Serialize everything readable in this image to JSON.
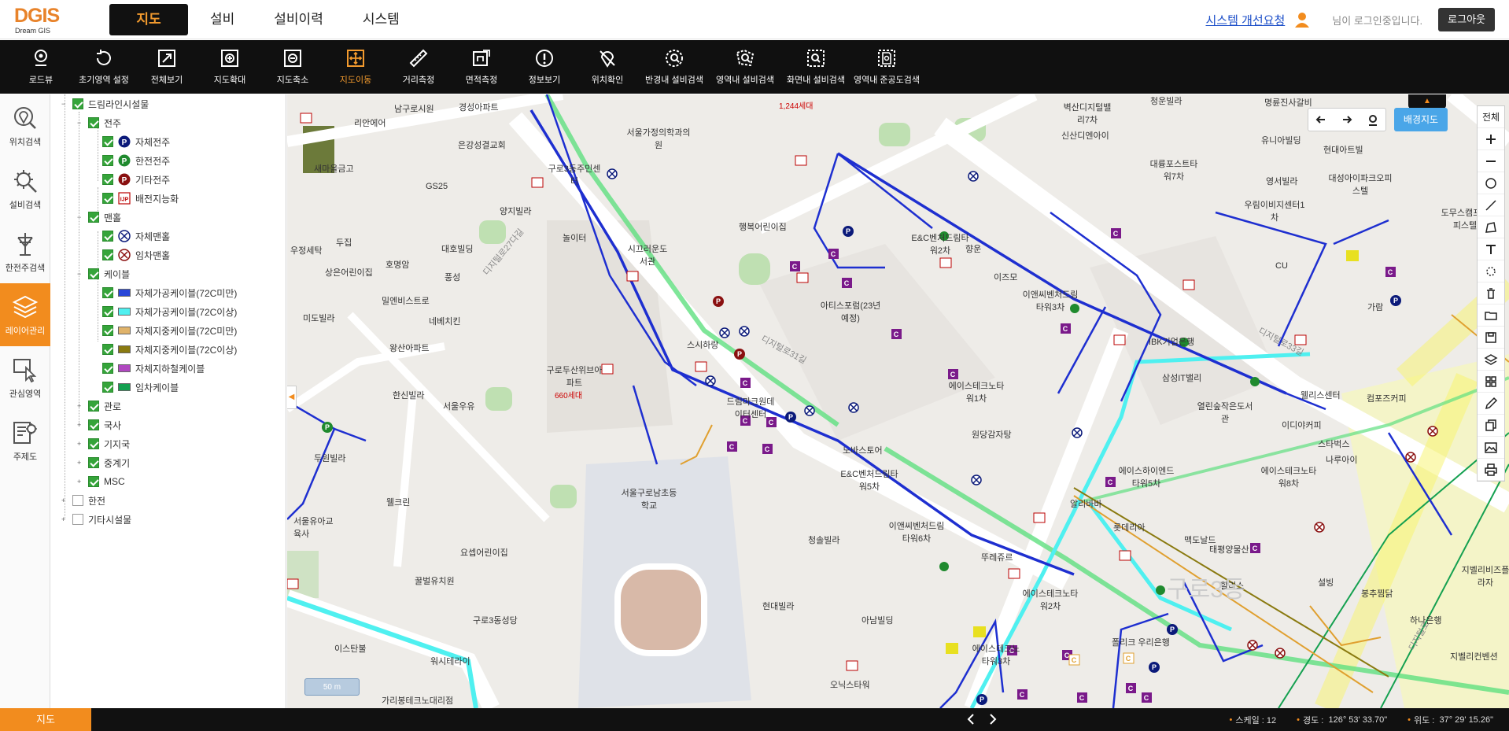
{
  "app": {
    "logo_text": "DGIS",
    "logo_sub": "Dream GIS"
  },
  "header": {
    "nav": [
      "지도",
      "설비",
      "설비이력",
      "시스템"
    ],
    "active_nav": "지도",
    "improve_link": "시스템 개선요청",
    "login_status": "님이 로그인중입니다.",
    "logout_label": "로그아웃"
  },
  "toolbar": {
    "tools": [
      {
        "label": "로드뷰",
        "icon": "roadview-icon"
      },
      {
        "label": "초기영역 설정",
        "icon": "reset-extent-icon"
      },
      {
        "label": "전체보기",
        "icon": "full-extent-icon"
      },
      {
        "label": "지도확대",
        "icon": "zoom-in-icon"
      },
      {
        "label": "지도축소",
        "icon": "zoom-out-icon"
      },
      {
        "label": "지도이동",
        "icon": "pan-icon"
      },
      {
        "label": "거리측정",
        "icon": "ruler-icon"
      },
      {
        "label": "면적측정",
        "icon": "area-measure-icon"
      },
      {
        "label": "정보보기",
        "icon": "info-icon"
      },
      {
        "label": "위치확인",
        "icon": "location-check-icon"
      },
      {
        "label": "반경내 설비검색",
        "icon": "radius-search-icon"
      },
      {
        "label": "영역내 설비검색",
        "icon": "area-search-icon"
      },
      {
        "label": "화면내 설비검색",
        "icon": "screen-search-icon"
      },
      {
        "label": "영역내 준공도검색",
        "icon": "completion-search-icon"
      }
    ],
    "active_tool": "지도이동"
  },
  "left_nav": {
    "items": [
      {
        "label": "위치검색",
        "icon": "location-search-icon"
      },
      {
        "label": "설비검색",
        "icon": "facility-search-icon"
      },
      {
        "label": "한전주검색",
        "icon": "kepco-pole-search-icon"
      },
      {
        "label": "레이어관리",
        "icon": "layers-icon"
      },
      {
        "label": "관심영역",
        "icon": "interest-area-icon"
      },
      {
        "label": "주제도",
        "icon": "thematic-map-icon"
      }
    ],
    "active": "레이어관리"
  },
  "layer_tree": {
    "root": "드림라인시설물",
    "pole_group": "전주",
    "poles": [
      "자체전주",
      "한전전주",
      "기타전주",
      "배전지능화"
    ],
    "manhole_group": "맨홀",
    "manholes": [
      "자체맨홀",
      "임차맨홀"
    ],
    "cable_group": "케이블",
    "cables": [
      {
        "label": "자체가공케이블(72C미만)",
        "color": "#2846d8"
      },
      {
        "label": "자체가공케이블(72C이상)",
        "color": "#4ff0f0"
      },
      {
        "label": "자체지중케이블(72C미만)",
        "color": "#e0b36a"
      },
      {
        "label": "자체지중케이블(72C이상)",
        "color": "#8a7a10"
      },
      {
        "label": "자체지하철케이블",
        "color": "#b048c0"
      },
      {
        "label": "임차케이블",
        "color": "#14a050"
      }
    ],
    "others": [
      "관로",
      "국사",
      "기지국",
      "중계기",
      "MSC"
    ],
    "bottom": [
      "한전",
      "기타시설물"
    ]
  },
  "map": {
    "bg_map_button": "배경지도",
    "full_button": "전체",
    "scale_bar": "50 m",
    "labels": [
      "남구로시원",
      "경성아파트",
      "리안에어",
      "새마을금고",
      "서울가정의학과의원",
      "구로3동주민센터",
      "은강성결교회",
      "GS25",
      "양지빌라",
      "놀이터",
      "시끄러운도서관",
      "행복어린이집",
      "두집",
      "우정세탁",
      "호명암",
      "대호빌딩",
      "풍성",
      "상은어린이집",
      "밀엔비스트로",
      "네베치킨",
      "미도빌라",
      "왕산아파트",
      "구로두산위브아파트",
      "660세대",
      "서울우유",
      "한신빌라",
      "두원빌라",
      "웰크린",
      "서울유아교육사",
      "요셉어린이집",
      "꿀벌유치원",
      "구로3동성당",
      "이스탄불",
      "워시테라이",
      "가리봉테크노대리점",
      "서울구로남초등학교",
      "드림마크원데이터센터",
      "스시하랑",
      "노바스토어",
      "E&C벤처드림타워5차",
      "청솔빌라",
      "현대빌라",
      "아남빌딩",
      "오닉스타워",
      "이앤씨벤처드림타워6차",
      "아티스포럼(23년예정)",
      "E&C벤처드림타워2차",
      "향운",
      "이즈모",
      "이앤씨벤처드림타워3차",
      "에이스테크노타워1차",
      "원당감자탕",
      "알리바바",
      "롯데리아",
      "맥도날드",
      "뚜레쥬르",
      "에이스테크노타워2차",
      "벽산디지털밸리7차",
      "신산디엔아이",
      "청운빌라",
      "명륜진사갈비",
      "유니아빌딩",
      "현대아트빌",
      "대륭포스트타워7차",
      "영서빌라",
      "대성아이파크오피스텔",
      "우림이비지센터1차",
      "IBK기업은행",
      "삼성IT밸리",
      "열린숲작은도서관",
      "에이스하이엔드타워5차",
      "웰리스센터",
      "컴포즈커피",
      "이디야커피",
      "스타벅스",
      "나루아이",
      "에이스테크노타워8차",
      "태평양물산",
      "할리스",
      "설빙",
      "봉추찜닭",
      "하나은행",
      "지벨리비즈플라자",
      "지벨리컨벤션",
      "도무스캠프오피스텔",
      "가람",
      "CU",
      "1,244세대",
      "구로3동",
      "디지털로31길",
      "디지털로27다길",
      "디지털로",
      "디지털로33길",
      "폴리크 우리은행",
      "에이스테크노타워3차"
    ]
  },
  "status": {
    "tab_label": "지도",
    "scale_label": "스케일 : 12",
    "lon_label": "경도 :",
    "lon_value": "126° 53' 33.70\"",
    "lat_label": "위도 :",
    "lat_value": "37° 29' 15.26\""
  },
  "colors": {
    "accent": "#f28c1e",
    "toolbar_bg": "#101010",
    "cable_blue": "#1e2fd0",
    "cable_cyan": "#4ff0f0",
    "cable_green": "#5fe080"
  }
}
